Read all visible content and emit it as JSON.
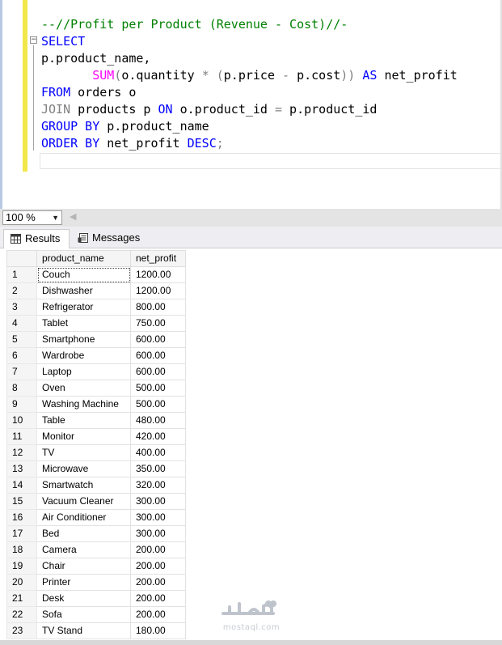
{
  "editor": {
    "lines": [
      [
        {
          "c": "cm",
          "t": "--//Profit per Product (Revenue - Cost)//-"
        }
      ],
      [
        {
          "c": "kw",
          "t": "SELECT"
        }
      ],
      [
        {
          "c": "",
          "t": "p.product_name,"
        }
      ],
      [
        {
          "c": "",
          "t": "       "
        },
        {
          "c": "fn",
          "t": "SUM"
        },
        {
          "c": "op",
          "t": "("
        },
        {
          "c": "",
          "t": "o.quantity "
        },
        {
          "c": "op",
          "t": "*"
        },
        {
          "c": "",
          "t": " "
        },
        {
          "c": "op",
          "t": "("
        },
        {
          "c": "",
          "t": "p.price "
        },
        {
          "c": "op",
          "t": "-"
        },
        {
          "c": "",
          "t": " p.cost"
        },
        {
          "c": "op",
          "t": "))"
        },
        {
          "c": "",
          "t": " "
        },
        {
          "c": "kw",
          "t": "AS"
        },
        {
          "c": "",
          "t": " net_profit"
        }
      ],
      [
        {
          "c": "kw",
          "t": "FROM"
        },
        {
          "c": "",
          "t": " orders o"
        }
      ],
      [
        {
          "c": "op",
          "t": "JOIN"
        },
        {
          "c": "",
          "t": " products p "
        },
        {
          "c": "kw",
          "t": "ON"
        },
        {
          "c": "",
          "t": " o.product_id "
        },
        {
          "c": "op",
          "t": "="
        },
        {
          "c": "",
          "t": " p.product_id"
        }
      ],
      [
        {
          "c": "kw",
          "t": "GROUP BY"
        },
        {
          "c": "",
          "t": " p.product_name"
        }
      ],
      [
        {
          "c": "kw",
          "t": "ORDER BY"
        },
        {
          "c": "",
          "t": " net_profit "
        },
        {
          "c": "kw",
          "t": "DESC"
        },
        {
          "c": "op",
          "t": ";"
        }
      ]
    ],
    "fold_glyph": "−"
  },
  "zoom": {
    "value": "100 %",
    "chevron": "▼",
    "scroll_left": "◀"
  },
  "tabs": {
    "results": "Results",
    "messages": "Messages"
  },
  "grid": {
    "columns": [
      "product_name",
      "net_profit"
    ],
    "rows": [
      [
        "1",
        "Couch",
        "1200.00"
      ],
      [
        "2",
        "Dishwasher",
        "1200.00"
      ],
      [
        "3",
        "Refrigerator",
        "800.00"
      ],
      [
        "4",
        "Tablet",
        "750.00"
      ],
      [
        "5",
        "Smartphone",
        "600.00"
      ],
      [
        "6",
        "Wardrobe",
        "600.00"
      ],
      [
        "7",
        "Laptop",
        "600.00"
      ],
      [
        "8",
        "Oven",
        "500.00"
      ],
      [
        "9",
        "Washing Machine",
        "500.00"
      ],
      [
        "10",
        "Table",
        "480.00"
      ],
      [
        "11",
        "Monitor",
        "420.00"
      ],
      [
        "12",
        "TV",
        "400.00"
      ],
      [
        "13",
        "Microwave",
        "350.00"
      ],
      [
        "14",
        "Smartwatch",
        "320.00"
      ],
      [
        "15",
        "Vacuum Cleaner",
        "300.00"
      ],
      [
        "16",
        "Air Conditioner",
        "300.00"
      ],
      [
        "17",
        "Bed",
        "300.00"
      ],
      [
        "18",
        "Camera",
        "200.00"
      ],
      [
        "19",
        "Chair",
        "200.00"
      ],
      [
        "20",
        "Printer",
        "200.00"
      ],
      [
        "21",
        "Desk",
        "200.00"
      ],
      [
        "22",
        "Sofa",
        "200.00"
      ],
      [
        "23",
        "TV Stand",
        "180.00"
      ]
    ]
  },
  "watermark": {
    "brand": "مستقل",
    "site": "mostaql.com"
  }
}
